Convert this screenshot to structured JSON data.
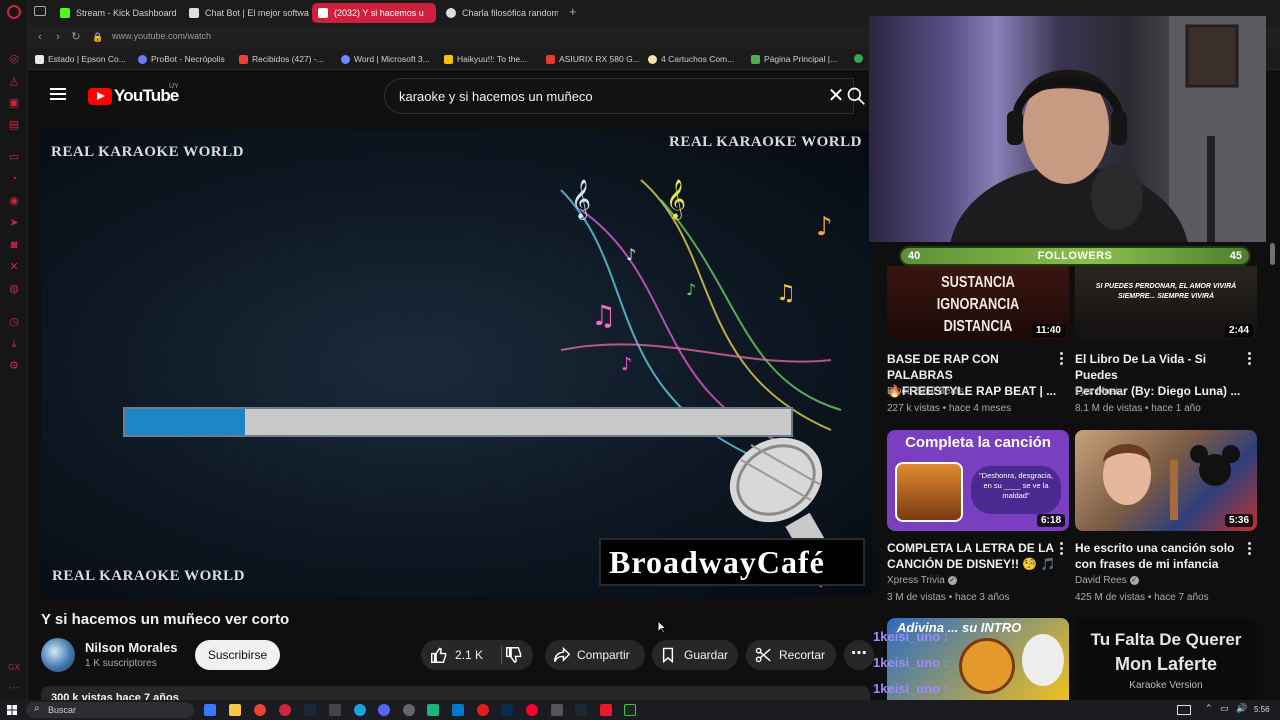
{
  "browser": {
    "tabs": [
      {
        "label": "Stream - Kick Dashboard",
        "color": "#53fc18"
      },
      {
        "label": "Chat Bot | El mejor softwa",
        "color": "#ffffff"
      },
      {
        "label": "(2032) Y si hacemos u",
        "color": "#ff3355"
      },
      {
        "label": "Charla filosófica random",
        "color": "#dddddd"
      }
    ],
    "url": "www.youtube.com/watch",
    "bookmarks": [
      {
        "label": "Estado | Epson Co...",
        "color": "#e8e8e8"
      },
      {
        "label": "ProBot - Necrópolis",
        "color": "#6b7cff"
      },
      {
        "label": "Recibidos (427) -...",
        "color": "#ea4335"
      },
      {
        "label": "Word | Microsoft 3...",
        "color": "#6b8cff"
      },
      {
        "label": "Haikyuu!!: To the...",
        "color": "#ffc107"
      },
      {
        "label": "ASIURIX RX 580 G...",
        "color": "#e53935"
      },
      {
        "label": "4 Cartuchos Com...",
        "color": "#f5e6a8"
      },
      {
        "label": "Página Principal |...",
        "color": "#4caf50"
      }
    ]
  },
  "youtube": {
    "logo_text": "YouTube",
    "region": "UY",
    "search_query": "karaoke y si hacemos un muñeco",
    "video": {
      "watermark_top_left": "REAL KARAOKE WORLD",
      "watermark_top_right": "REAL KARAOKE WORLD",
      "watermark_bottom_left": "REAL KARAOKE WORLD",
      "logo_text": "BroadwayCafé",
      "progress": 0.18
    },
    "title": "Y si hacemos un muñeco ver corto",
    "channel": {
      "name": "Nilson Morales",
      "subscribers": "1 K suscriptores"
    },
    "subscribe_label": "Suscribirse",
    "likes": "2.1 K",
    "share_label": "Compartir",
    "save_label": "Guardar",
    "clip_label": "Recortar",
    "stats": "300 k vistas  hace 7 años"
  },
  "overlay": {
    "followers_left": "40",
    "followers_label": "FOLLOWERS",
    "followers_right": "45",
    "followers_progress": 0.5
  },
  "related": [
    {
      "title_line1": "BASE DE RAP CON PALABRAS",
      "title_line2": "🔥FREESTYLE RAP BEAT | ...",
      "channel": "Blood Soul Beats",
      "meta": "227 k vistas • hace 4 meses",
      "duration": "11:40",
      "thumb_lines": [
        "SUSTANCIA",
        "IGNORANCIA",
        "DISTANCIA"
      ]
    },
    {
      "title_line1": "El Libro De La Vida - Si Puedes",
      "title_line2": "Perdonar (By: Diego Luna) ...",
      "channel": "Lyrx Music",
      "meta": "8.1 M de vistas • hace 1 año",
      "duration": "2:44",
      "thumb_lines": [
        "SI PUEDES PERDONAR, EL AMOR VIVIRÁ",
        "SIEMPRE... SIEMPRE VIVIRÁ"
      ]
    },
    {
      "title_line1": "COMPLETA LA LETRA DE LA",
      "title_line2": "CANCIÓN DE DISNEY!! 🧐 🎵",
      "channel": "Xpress Trivia",
      "meta": "3 M de vistas • hace 3 años",
      "duration": "6:18",
      "thumb_lines": [
        "Completa la canción",
        "\"Deshonra, desgracia, en su ____ se ve la maldad\""
      ]
    },
    {
      "title_line1": "He escrito una canción solo",
      "title_line2": "con frases de mi infancia",
      "channel": "David Rees",
      "meta": "425 M de vistas • hace 7 años",
      "duration": "5:36",
      "thumb_lines": []
    },
    {
      "thumb_lines": [
        "Adivina ... su INTRO"
      ],
      "chat_lines": [
        "1keisi_uno :",
        "1keisi_uno :",
        "1keisi_uno :"
      ]
    },
    {
      "thumb_lines": [
        "Tu Falta De Querer",
        "Mon Laferte",
        "Karaoke Version"
      ]
    }
  ],
  "taskbar": {
    "search_label": "Buscar",
    "time": "5:56"
  }
}
